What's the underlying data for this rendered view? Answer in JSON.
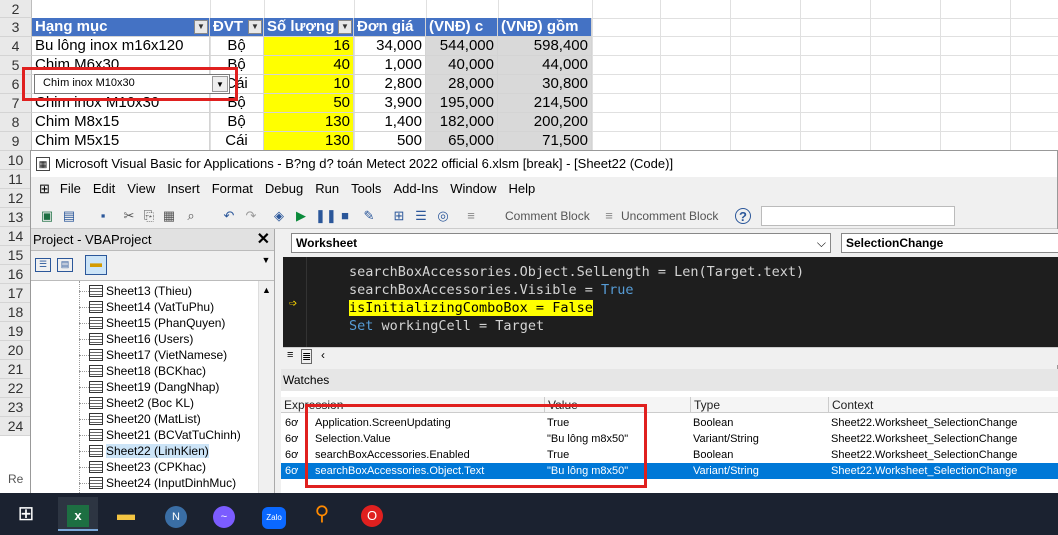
{
  "excel": {
    "row_numbers": [
      "2",
      "3",
      "4",
      "5",
      "6",
      "7",
      "8",
      "9",
      "10",
      "11",
      "12",
      "13",
      "14",
      "15",
      "16",
      "17",
      "18",
      "19",
      "20",
      "21",
      "22",
      "23",
      "24"
    ],
    "headers": [
      "Hạng mục",
      "ĐVT",
      "Số lượng",
      "Đơn giá",
      "(VNĐ) c",
      "(VNĐ) gồm"
    ],
    "rows": [
      [
        "Bu lông inox m16x120",
        "Bộ",
        "16",
        "34,000",
        "544,000",
        "598,400"
      ],
      [
        "Chim M6x30",
        "Bộ",
        "40",
        "1,000",
        "40,000",
        "44,000"
      ],
      [
        "Chim inox M10x30",
        "Cái",
        "10",
        "2,800",
        "28,000",
        "30,800"
      ],
      [
        "Chim inox M10x30",
        "Bộ",
        "50",
        "3,900",
        "195,000",
        "214,500"
      ],
      [
        "Chim M8x15",
        "Bộ",
        "130",
        "1,400",
        "182,000",
        "200,200"
      ],
      [
        "Chim M5x15",
        "Cái",
        "130",
        "500",
        "65,000",
        "71,500"
      ]
    ],
    "combo_value": "Chìm inox M10x30",
    "sheet_tab_hint": "Re"
  },
  "vba": {
    "title": "Microsoft Visual Basic for Applications - B?ng d? toán Metect 2022 official 6.xlsm [break] - [Sheet22 (Code)]",
    "menu": [
      "File",
      "Edit",
      "View",
      "Insert",
      "Format",
      "Debug",
      "Run",
      "Tools",
      "Add-Ins",
      "Window",
      "Help"
    ],
    "toolbar": {
      "comment_block": "Comment Block",
      "uncomment_block": "Uncomment Block"
    },
    "project": {
      "title": "Project - VBAProject",
      "items": [
        "Sheet13 (Thieu)",
        "Sheet14 (VatTuPhu)",
        "Sheet15 (PhanQuyen)",
        "Sheet16 (Users)",
        "Sheet17 (VietNamese)",
        "Sheet18 (BCKhac)",
        "Sheet19 (DangNhap)",
        "Sheet2 (Boc KL)",
        "Sheet20 (MatList)",
        "Sheet21 (BCVatTuChinh)",
        "Sheet22 (LinhKien)",
        "Sheet23 (CPKhac)",
        "Sheet24 (InputDinhMuc)"
      ]
    },
    "object_combo": "Worksheet",
    "proc_combo": "SelectionChange",
    "code": {
      "line1_a": "searchBoxAccessories.Object.SelLength = Len(Target.text)",
      "line2_a": "searchBoxAccessories.Visible = ",
      "line2_b": "True",
      "line3_a": "isInitializingComboBox = False",
      "line4_a": "Set",
      "line4_b": " workingCell = Target"
    },
    "watches": {
      "title": "Watches",
      "columns": [
        "Expression",
        "Value",
        "Type",
        "Context"
      ],
      "rows": [
        {
          "icon": "6ơ",
          "expr": "Application.ScreenUpdating",
          "value": "True",
          "type": "Boolean",
          "context": "Sheet22.Worksheet_SelectionChange"
        },
        {
          "icon": "6ơ",
          "expr": "Selection.Value",
          "value": "\"Bu lông m8x50\"",
          "type": "Variant/String",
          "context": "Sheet22.Worksheet_SelectionChange"
        },
        {
          "icon": "6ơ",
          "expr": "searchBoxAccessories.Enabled",
          "value": "True",
          "type": "Boolean",
          "context": "Sheet22.Worksheet_SelectionChange"
        },
        {
          "icon": "6ơ",
          "expr": "searchBoxAccessories.Object.Text",
          "value": "\"Bu lông m8x50\"",
          "type": "Variant/String",
          "context": "Sheet22.Worksheet_SelectionChange"
        }
      ]
    }
  },
  "taskbar": {
    "apps": [
      "windows-start",
      "excel",
      "file-explorer",
      "network-app",
      "messenger",
      "zalo",
      "search-app",
      "opera"
    ]
  },
  "colors": {
    "header_blue": "#4472c4",
    "highlight_yellow": "#ffff00",
    "annotation_red": "#e0201f",
    "selection_blue": "#0078d7"
  }
}
